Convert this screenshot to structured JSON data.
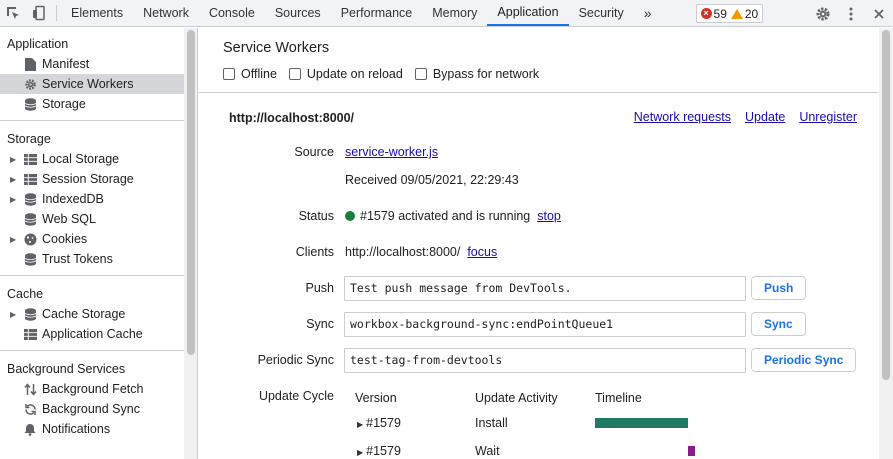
{
  "toolbar": {
    "tabs": [
      {
        "label": "Elements"
      },
      {
        "label": "Network"
      },
      {
        "label": "Console"
      },
      {
        "label": "Sources"
      },
      {
        "label": "Performance"
      },
      {
        "label": "Memory"
      },
      {
        "label": "Application"
      },
      {
        "label": "Security"
      }
    ],
    "more": "»",
    "error_count": "59",
    "warning_count": "20",
    "active_tab": "Application"
  },
  "sidebar": {
    "application": {
      "heading": "Application",
      "items": [
        {
          "label": "Manifest",
          "icon": "file-icon"
        },
        {
          "label": "Service Workers",
          "icon": "gear-icon"
        },
        {
          "label": "Storage",
          "icon": "database-icon"
        }
      ]
    },
    "storage": {
      "heading": "Storage",
      "items": [
        {
          "label": "Local Storage",
          "icon": "grid-icon"
        },
        {
          "label": "Session Storage",
          "icon": "grid-icon"
        },
        {
          "label": "IndexedDB",
          "icon": "database-icon"
        },
        {
          "label": "Web SQL",
          "icon": "database-icon"
        },
        {
          "label": "Cookies",
          "icon": "cookie-icon"
        },
        {
          "label": "Trust Tokens",
          "icon": "database-icon"
        }
      ]
    },
    "cache": {
      "heading": "Cache",
      "items": [
        {
          "label": "Cache Storage",
          "icon": "database-icon"
        },
        {
          "label": "Application Cache",
          "icon": "grid-icon"
        }
      ]
    },
    "background": {
      "heading": "Background Services",
      "items": [
        {
          "label": "Background Fetch",
          "icon": "arrows-updown-icon"
        },
        {
          "label": "Background Sync",
          "icon": "sync-icon"
        },
        {
          "label": "Notifications",
          "icon": "bell-icon"
        }
      ]
    }
  },
  "main": {
    "title": "Service Workers",
    "options": {
      "offline": "Offline",
      "update_on_reload": "Update on reload",
      "bypass": "Bypass for network"
    },
    "origin": "http://localhost:8000/",
    "links": {
      "network_requests": "Network requests",
      "update": "Update",
      "unregister": "Unregister"
    },
    "source_label": "Source",
    "source_link": "service-worker.js",
    "received": "Received 09/05/2021, 22:29:43",
    "status_label": "Status",
    "status_text": "#1579 activated and is running",
    "status_link": "stop",
    "clients_label": "Clients",
    "clients_value": "http://localhost:8000/",
    "clients_link": "focus",
    "push_label": "Push",
    "push_value": "Test push message from DevTools.",
    "push_button": "Push",
    "sync_label": "Sync",
    "sync_value": "workbox-background-sync:endPointQueue1",
    "sync_button": "Sync",
    "periodic_label": "Periodic Sync",
    "periodic_value": "test-tag-from-devtools",
    "periodic_button": "Periodic Sync",
    "update_cycle_label": "Update Cycle",
    "cycle_headers": {
      "version": "Version",
      "activity": "Update Activity",
      "timeline": "Timeline"
    },
    "cycle_rows": [
      {
        "version": "#1579",
        "activity": "Install",
        "color": "#1e7a62"
      },
      {
        "version": "#1579",
        "activity": "Wait",
        "color": "#8a1a8a"
      }
    ]
  }
}
